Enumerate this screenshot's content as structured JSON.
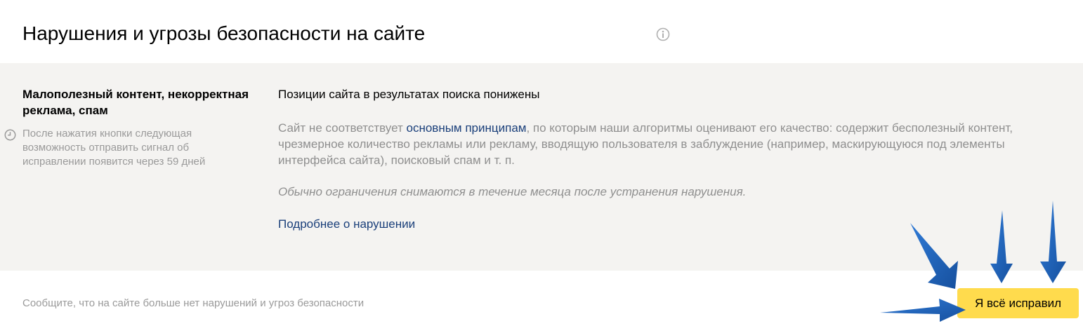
{
  "header": {
    "title": "Нарушения и угрозы безопасности на сайте",
    "info_icon": "info-circle-icon"
  },
  "violation": {
    "title": "Малополезный контент, некорректная реклама, спам",
    "cooldown_icon": "clock-icon",
    "cooldown_note": "После нажатия кнопки следующая возможность отправить сигнал об исправлении появится через 59 дней",
    "status_heading": "Позиции сайта в результатах поиска понижены",
    "description_before": "Сайт не соответствует ",
    "principles_link": "основным принципам",
    "description_after": ", по которым наши алгоритмы оценивают его качество: содержит бесполезный контент, чрезмерное количество рекламы или рекламу, вводящую пользователя в заблуждение (например, маскирующуюся под элементы интерфейса сайта), поисковый спам и т. п.",
    "restriction_note": "Обычно ограничения снимаются в течение месяца после устранения нарушения.",
    "details_link": "Подробнее о нарушении"
  },
  "footer": {
    "prompt": "Сообщите, что на сайте больше нет нарушений и угроз безопасности",
    "fixed_button": "Я всё исправил"
  },
  "colors": {
    "panel_bg": "#f4f3f1",
    "link": "#1a3f7a",
    "button_bg": "#ffdb4d",
    "arrow": "#1b5fb8"
  }
}
